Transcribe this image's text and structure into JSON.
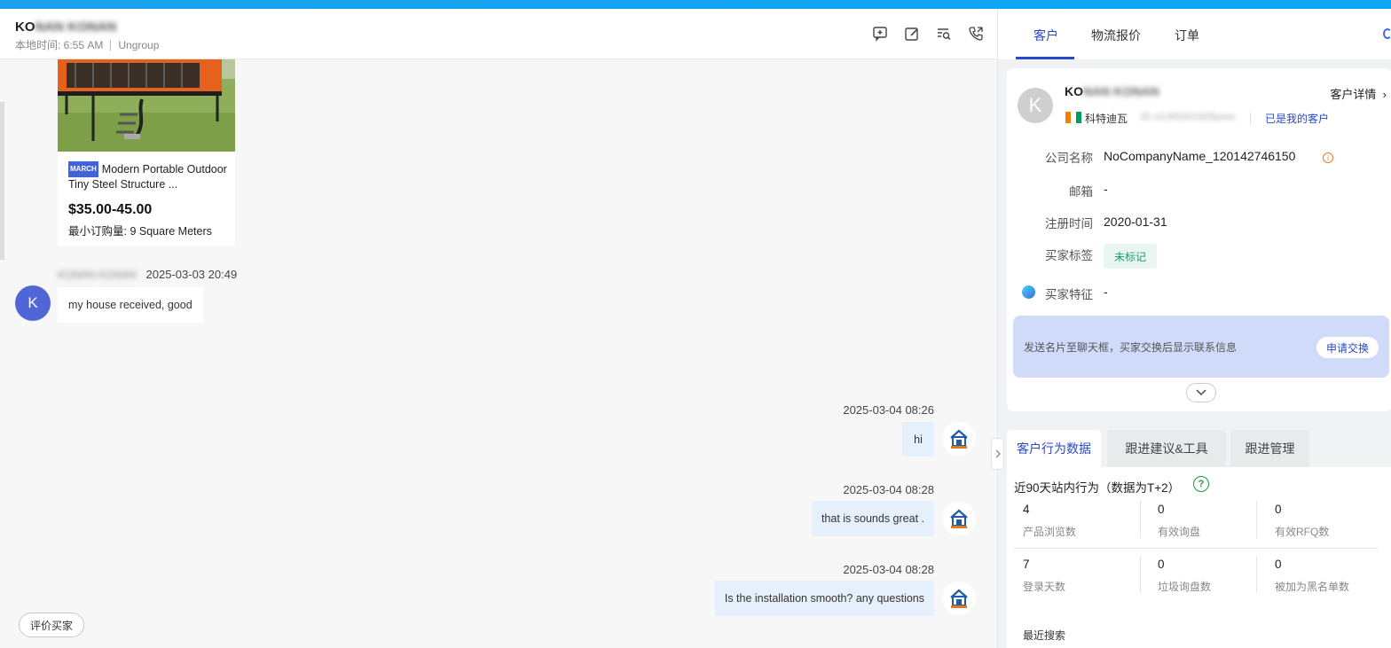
{
  "header": {
    "contact_name_visible": "KO",
    "contact_name_blurred": "NAN KONAN",
    "local_time": "本地时间: 6:55 AM",
    "group": "Ungroup",
    "icons": [
      "add-comment-icon",
      "edit-icon",
      "search-list-icon",
      "phone-forward-icon"
    ]
  },
  "product": {
    "badge": "MARCH",
    "title": "Modern Portable Outdoor Tiny Steel Structure ...",
    "price": "$35.00-45.00",
    "moq_label": "最小订购量:",
    "moq_value": "9 Square Meters"
  },
  "messages": {
    "incoming": {
      "sender": "KONAN KONAN",
      "timestamp": "2025-03-03 20:49",
      "avatar_letter": "K",
      "text": "my house received, good"
    },
    "outgoing": [
      {
        "timestamp": "2025-03-04 08:26",
        "text": "hi"
      },
      {
        "timestamp": "2025-03-04 08:28",
        "text": "that is sounds great ."
      },
      {
        "timestamp": "2025-03-04 08:28",
        "text": "Is the installation smooth? any questions"
      }
    ]
  },
  "eval_button": "评价买家",
  "panel": {
    "tabs": [
      "客户",
      "物流报价",
      "订单"
    ],
    "customer": {
      "avatar_letter": "K",
      "name_visible": "KO",
      "name_blurred": "NAN KONAN",
      "detail_link": "客户详情",
      "country": "科特迪瓦",
      "id_text": "ID ci1365201925yxou",
      "ownership": "已是我的客户",
      "fields": {
        "company_label": "公司名称",
        "company_value": "NoCompanyName_120142746150",
        "email_label": "邮箱",
        "email_value": "-",
        "reg_label": "注册时间",
        "reg_value": "2020-01-31",
        "tag_label": "买家标签",
        "tag_value": "未标记",
        "trait_label": "买家特征",
        "trait_value": "-"
      },
      "banner_text": "发送名片至聊天框，买家交换后显示联系信息",
      "banner_button": "申请交换"
    },
    "behavior_tabs": [
      "客户行为数据",
      "跟进建议&工具",
      "跟进管理"
    ],
    "behavior": {
      "title": "近90天站内行为（数据为T+2）",
      "stats": [
        {
          "value": "4",
          "label": "产品浏览数"
        },
        {
          "value": "0",
          "label": "有效询盘"
        },
        {
          "value": "0",
          "label": "有效RFQ数"
        },
        {
          "value": "7",
          "label": "登录天数"
        },
        {
          "value": "0",
          "label": "垃圾询盘数"
        },
        {
          "value": "0",
          "label": "被加为黑名单数"
        }
      ],
      "recent_search": "最近搜索"
    }
  },
  "colors": {
    "accent": "#2a49c6",
    "topbar": "#1aa2f0",
    "bubble_out": "#e6effc",
    "avatar_incoming": "#5166d6"
  }
}
